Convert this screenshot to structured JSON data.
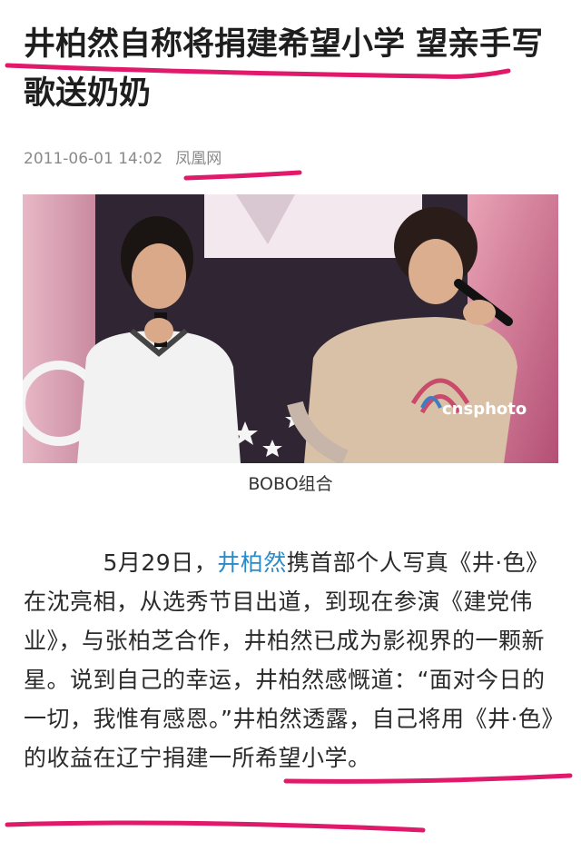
{
  "article": {
    "headline": "井柏然自称将捐建希望小学 望亲手写歌送奶奶",
    "date": "2011-06-01 14:02",
    "source": "凤凰网"
  },
  "photo": {
    "watermark": "cnsphoto",
    "caption": "BOBO组合"
  },
  "body": {
    "before_link": "5月29日，",
    "link": "井柏然",
    "after_link": "携首部个人写真《井·色》在沈亮相，从选秀节目出道，到现在参演《建党伟业》，与张柏芝合作，井柏然已成为影视界的一颗新星。说到自己的幸运，井柏然感慨道：“面对今日的一切，我惟有感恩。”井柏然透露，自己将用《井·色》的收益在辽宁捐建一所希望小学。"
  },
  "colors": {
    "highlight": "#e0196b",
    "link": "#2b8bc9"
  }
}
